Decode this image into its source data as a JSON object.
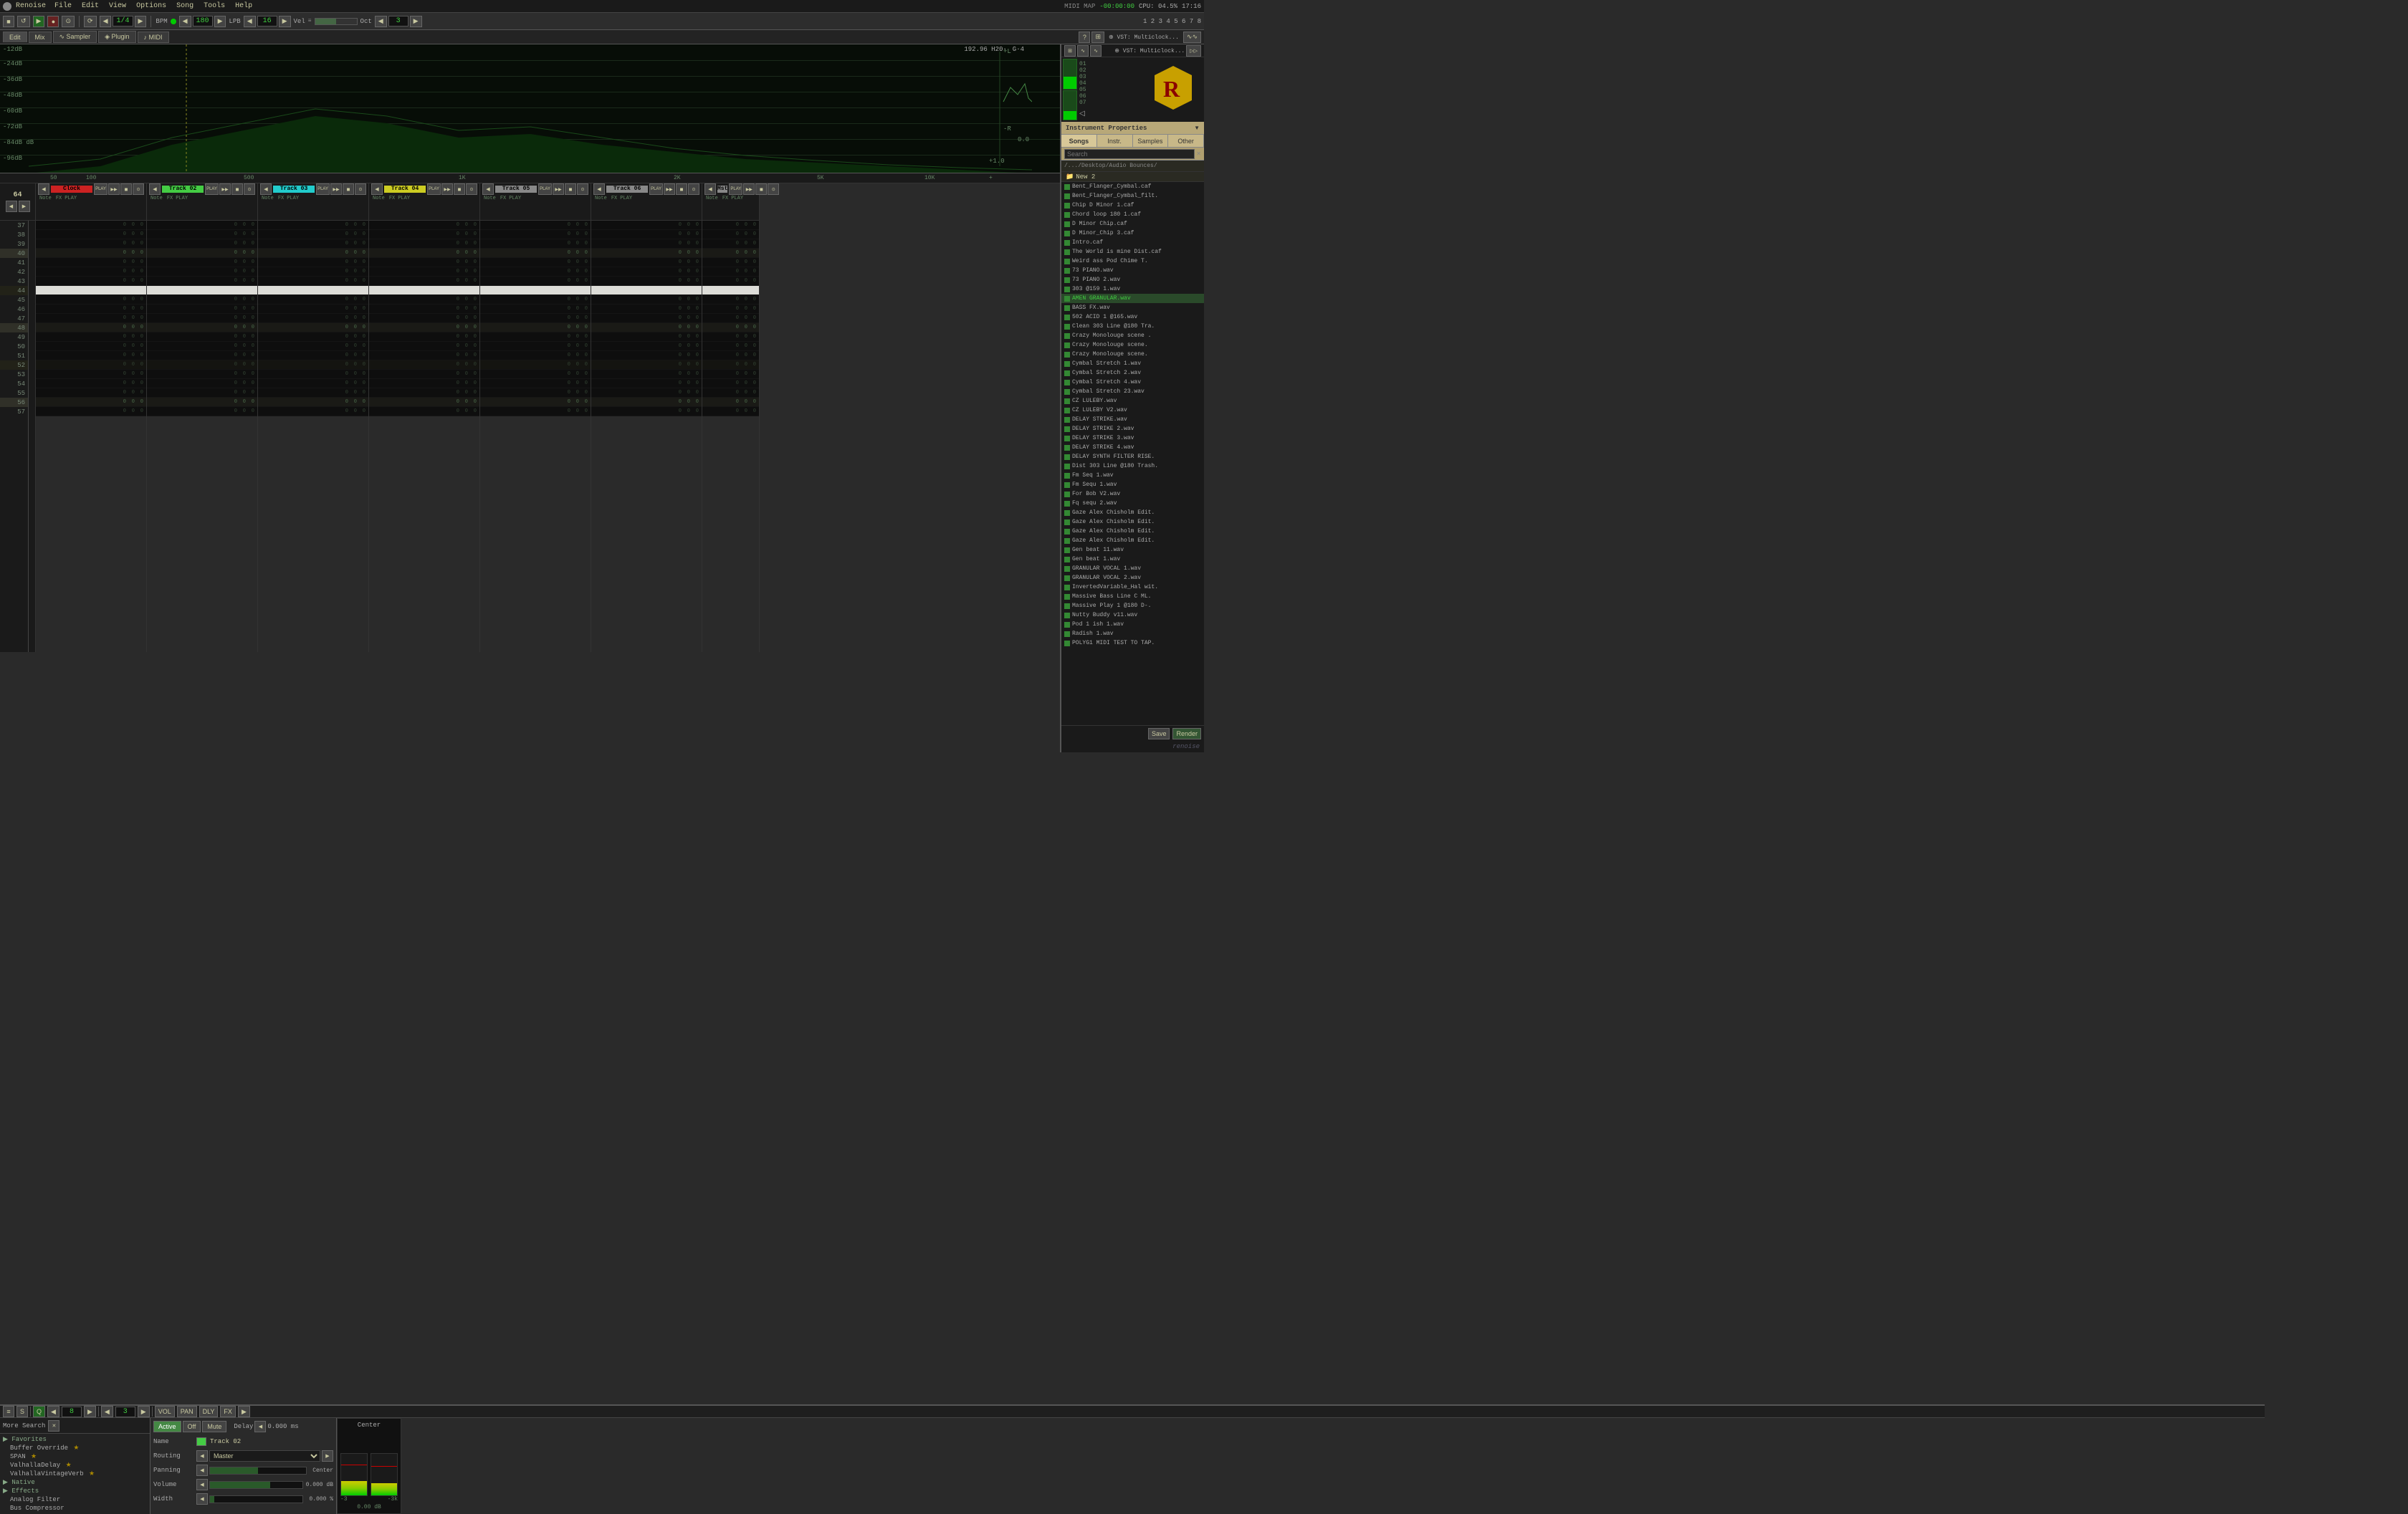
{
  "app": {
    "title": "Renoise",
    "window_title": "Renoise"
  },
  "menu": {
    "items": [
      "File",
      "Edit",
      "View",
      "Options",
      "Song",
      "Tools",
      "Help"
    ]
  },
  "transport": {
    "bpm_label": "BPM",
    "bpm_value": "180",
    "lpb_label": "LPB",
    "lpb_value": "16",
    "vel_label": "Vel",
    "oct_label": "Oct",
    "oct_value": "3",
    "pattern_label": "1/4",
    "time_display": "-00:00:00",
    "cpu_label": "CPU: 04.5%",
    "time_label": "17:16"
  },
  "tabs": {
    "items": [
      "Edit",
      "Mix",
      "Sampler",
      "Plugin",
      "MIDI"
    ]
  },
  "spectrum": {
    "db_labels": [
      "-12dB",
      "-24dB",
      "-36dB",
      "-48dB",
      "-60dB",
      "-72dB",
      "-84dB dB",
      "-96dB"
    ]
  },
  "ruler": {
    "marks": [
      "50",
      "100",
      "192.96 H20·",
      "G·4",
      "500",
      "1K",
      "2K",
      "5K",
      "10K"
    ]
  },
  "tracks": {
    "columns": [
      {
        "id": 1,
        "name": "Clock",
        "color": "#cc2222",
        "num_label": "64"
      },
      {
        "id": 2,
        "name": "Track 02",
        "color": "#44cc44",
        "num_label": ""
      },
      {
        "id": 3,
        "name": "Track 03",
        "color": "#22cccc",
        "num_label": ""
      },
      {
        "id": 4,
        "name": "Track 04",
        "color": "#cccc22",
        "num_label": ""
      },
      {
        "id": 5,
        "name": "Track 05",
        "color": "#888888",
        "num_label": ""
      },
      {
        "id": 6,
        "name": "Track 06",
        "color": "#888888",
        "num_label": ""
      },
      {
        "id": 7,
        "name": "Mst",
        "color": "#888888",
        "num_label": ""
      }
    ],
    "row_numbers": [
      37,
      38,
      39,
      40,
      41,
      42,
      43,
      44,
      45,
      46,
      47,
      48,
      49,
      50,
      51,
      52,
      53,
      54,
      55,
      56,
      57
    ],
    "playhead_row": 44
  },
  "right_panel": {
    "instrument_props_label": "Instrument Properties",
    "logo_letter": "R",
    "tabs": [
      "Songs",
      "Instr.",
      "Samples",
      "Other"
    ],
    "search_placeholder": "Search",
    "path": "/.../Desktop/Audio Bounces/",
    "folder": "New 2",
    "files": [
      "Bent_Flanger_Cymbal.caf",
      "Bent_Flanger_Cymbal_filt.",
      "Chip D Minor 1.caf",
      "Chord loop 180 1.caf",
      "D Minor Chip.caf",
      "D Minor_Chip 3.caf",
      "Intro.caf",
      "The World is mine Dist.caf",
      "Weird ass Pod Chime T.",
      "73 PIANO.wav",
      "73 PIANO 2.wav",
      "303 @159 1.wav",
      "AMEN GRANULAR.wav",
      "BASS FX.wav",
      "502 ACID 1 @165.wav",
      "Clean 303 Line @180 Tra.",
      "Crazy Monolouge scene .",
      "Crazy Monolouge scene.",
      "Crazy Monolouge scene.",
      "Cymbal Stretch 1.wav",
      "Cymbal Stretch 2.wav",
      "Cymbal Stretch 4.wav",
      "Cymbal Stretch 23.wav",
      "CZ LULEBY.wav",
      "CZ LULEBY V2.wav",
      "DELAY STRIKE.wav",
      "DELAY STRIKE 2.wav",
      "DELAY STRIKE 3.wav",
      "DELAY STRIKE 4.wav",
      "DELAY SYNTH FILTER RISE.",
      "Dist 303 Line @180 Trash.",
      "Fm Seq 1.wav",
      "Fm Sequ 1.wav",
      "For Bob V2.wav",
      "Fq sequ 2.wav",
      "Gaze Alex Chisholm Edit.",
      "Gaze Alex Chisholm Edit.",
      "Gaze Alex Chisholm Edit.",
      "Gaze Alex Chisholm Edit.",
      "Gen beat 11.wav",
      "Gen beat 1.wav",
      "GRANULAR VOCAL 1.wav",
      "GRANULAR VOCAL 2.wav",
      "InvertedVariable_Hal wit.",
      "Massive Bass Line C ML.",
      "Massive Play 1 @180 D-.",
      "Nutty Buddy v11.wav",
      "Pod 1 ish 1.wav",
      "Radish 1.wav",
      "POLYG1 MIDI TEST TO TAP."
    ]
  },
  "bottom_panel": {
    "search_label": "More Search",
    "search_placeholder": "Search",
    "active_btn": "Active",
    "off_btn": "Off",
    "mute_btn": "Mute",
    "delay_label": "Delay",
    "delay_value": "0.000 ms",
    "fx_categories": [
      {
        "name": "Favorites",
        "items": [
          "Buffer Override",
          "SPAN",
          "ValhallaDelay",
          "ValhallaVintageVerb"
        ]
      },
      {
        "name": "Native",
        "items": []
      },
      {
        "name": "Effects",
        "items": [
          "Analog Filter",
          "Bus Compressor"
        ]
      }
    ],
    "track_props": {
      "name_label": "Name",
      "name_value": "Track 02",
      "routing_label": "Routing",
      "routing_value": "Master",
      "panning_label": "Panning",
      "panning_value": "Center",
      "volume_label": "Volume",
      "volume_value": "0.000 dB",
      "width_label": "Width",
      "width_value": "0.000 %"
    },
    "meter": {
      "label": "Center",
      "values": [
        "-3",
        "-3k"
      ],
      "db_value": "0.00 dB"
    }
  }
}
